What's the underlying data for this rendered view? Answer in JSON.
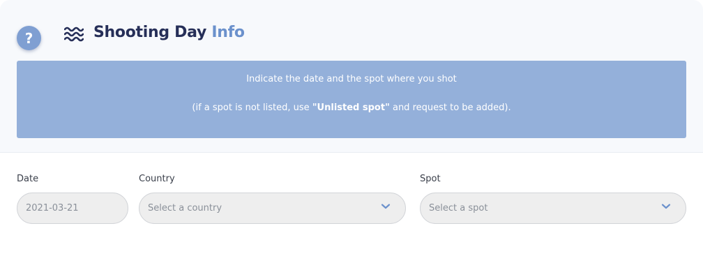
{
  "header": {
    "title_main": "Shooting Day",
    "title_accent": "Info",
    "help_icon": "question-circle-icon",
    "section_icon": "waves-icon"
  },
  "banner": {
    "line1": "Indicate the date and the spot where you shot",
    "line2_before": "(if a spot is not listed, use ",
    "line2_bold": "\"Unlisted spot\"",
    "line2_after": " and request to be added)."
  },
  "form": {
    "date_label": "Date",
    "date_value": "2021-03-21",
    "country_label": "Country",
    "country_placeholder": "Select a country",
    "spot_label": "Spot",
    "spot_placeholder": "Select a spot"
  },
  "colors": {
    "accent": "#6b91cc",
    "banner_bg": "#94b0da",
    "title": "#262f58"
  }
}
